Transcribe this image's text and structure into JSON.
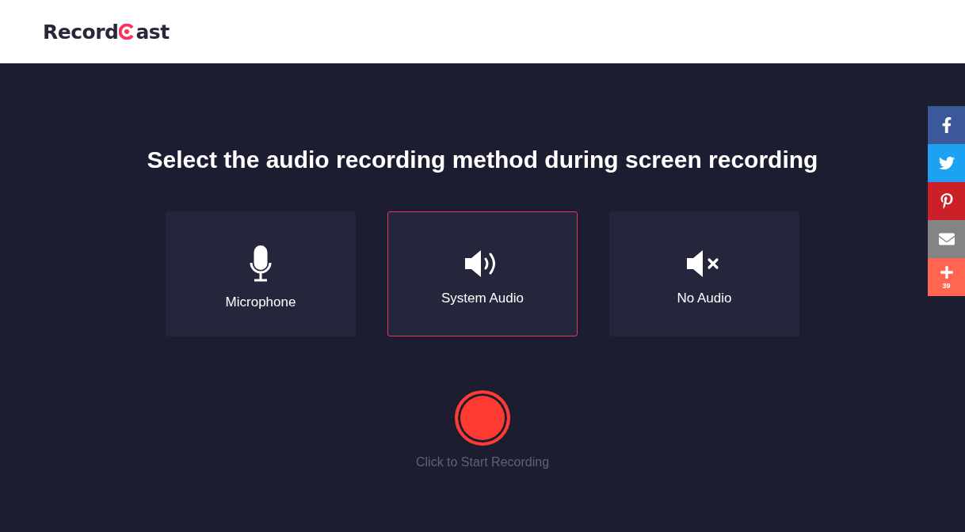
{
  "logo": {
    "text_before": "Record",
    "text_after": "ast"
  },
  "heading": "Select the audio recording method during screen recording",
  "options": [
    {
      "kind": "microphone",
      "label": "Microphone",
      "selected": false
    },
    {
      "kind": "system",
      "label": "System Audio",
      "selected": true
    },
    {
      "kind": "mute",
      "label": "No Audio",
      "selected": false
    }
  ],
  "record_button": {
    "caption": "Click to Start Recording"
  },
  "share_bar": [
    {
      "kind": "facebook",
      "color": "#3b5998"
    },
    {
      "kind": "twitter",
      "color": "#1da1f2"
    },
    {
      "kind": "pinterest",
      "color": "#cb2027"
    },
    {
      "kind": "email",
      "color": "#848484"
    },
    {
      "kind": "more",
      "color": "#ff6550",
      "count": "39"
    }
  ]
}
